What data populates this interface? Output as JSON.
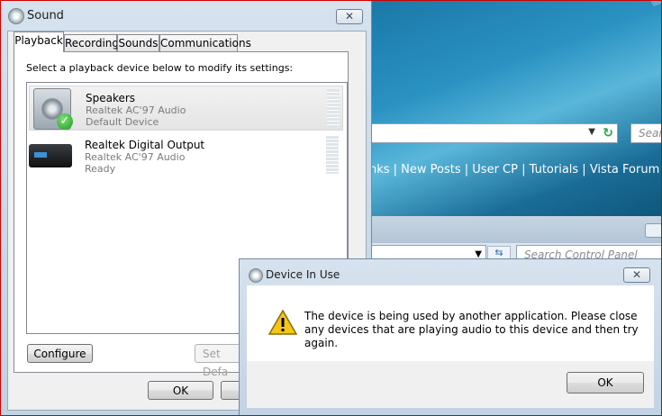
{
  "browser": {
    "search_placeholder": "Sear",
    "links": "nks | New Posts | User CP | Tutorials | Vista Forum | Vid"
  },
  "control_panel": {
    "search_placeholder": "Search Control Panel"
  },
  "sound_dialog": {
    "title": "Sound",
    "close_label": "✕",
    "tabs": [
      "Playback",
      "Recording",
      "Sounds",
      "Communications"
    ],
    "prompt": "Select a playback device below to modify its settings:",
    "devices": [
      {
        "name": "Speakers",
        "driver": "Realtek AC'97 Audio",
        "status": "Default Device",
        "icon": "speaker-icon"
      },
      {
        "name": "Realtek Digital Output",
        "driver": "Realtek AC'97 Audio",
        "status": "Ready",
        "icon": "digital-output-icon"
      }
    ],
    "configure_label": "Configure",
    "set_default_label": "Set Defa",
    "ok_label": "OK"
  },
  "device_in_use_dialog": {
    "title": "Device In Use",
    "close_label": "✕",
    "message": "The device is being used by another application.  Please close any devices that are playing audio to this device and then try again.",
    "ok_label": "OK",
    "icon": "warning-icon"
  }
}
